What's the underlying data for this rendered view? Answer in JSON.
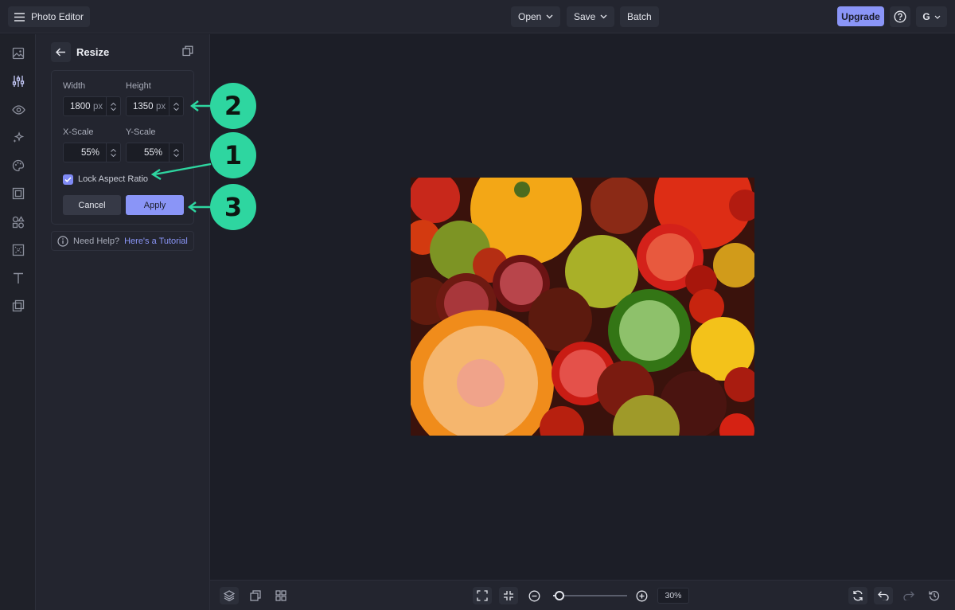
{
  "topbar": {
    "app_title": "Photo Editor",
    "open_label": "Open",
    "save_label": "Save",
    "batch_label": "Batch",
    "upgrade_label": "Upgrade",
    "user_initial": "G"
  },
  "rail": {
    "items": [
      "image-icon",
      "adjustments-icon",
      "eye-icon",
      "sparkle-icon",
      "palette-icon",
      "frame-icon",
      "shapes-icon",
      "texture-icon",
      "text-icon",
      "overlay-icon"
    ],
    "active_index": 1
  },
  "panel": {
    "title": "Resize",
    "width_label": "Width",
    "height_label": "Height",
    "width_value": "1800",
    "height_value": "1350",
    "unit": "px",
    "xscale_label": "X-Scale",
    "yscale_label": "Y-Scale",
    "xscale_value": "55%",
    "yscale_value": "55%",
    "lock_label": "Lock Aspect Ratio",
    "lock_checked": true,
    "cancel_label": "Cancel",
    "apply_label": "Apply",
    "help_text": "Need Help?",
    "tutorial_link": "Here's a Tutorial"
  },
  "bottombar": {
    "zoom_label": "30%",
    "zoom_fraction": 0.3
  },
  "annotations": {
    "callouts": [
      "2",
      "1",
      "3"
    ],
    "color": "#2ed6a0"
  },
  "colors": {
    "accent": "#8a95f7",
    "background": "#1c1e27",
    "panel": "#23252f"
  }
}
